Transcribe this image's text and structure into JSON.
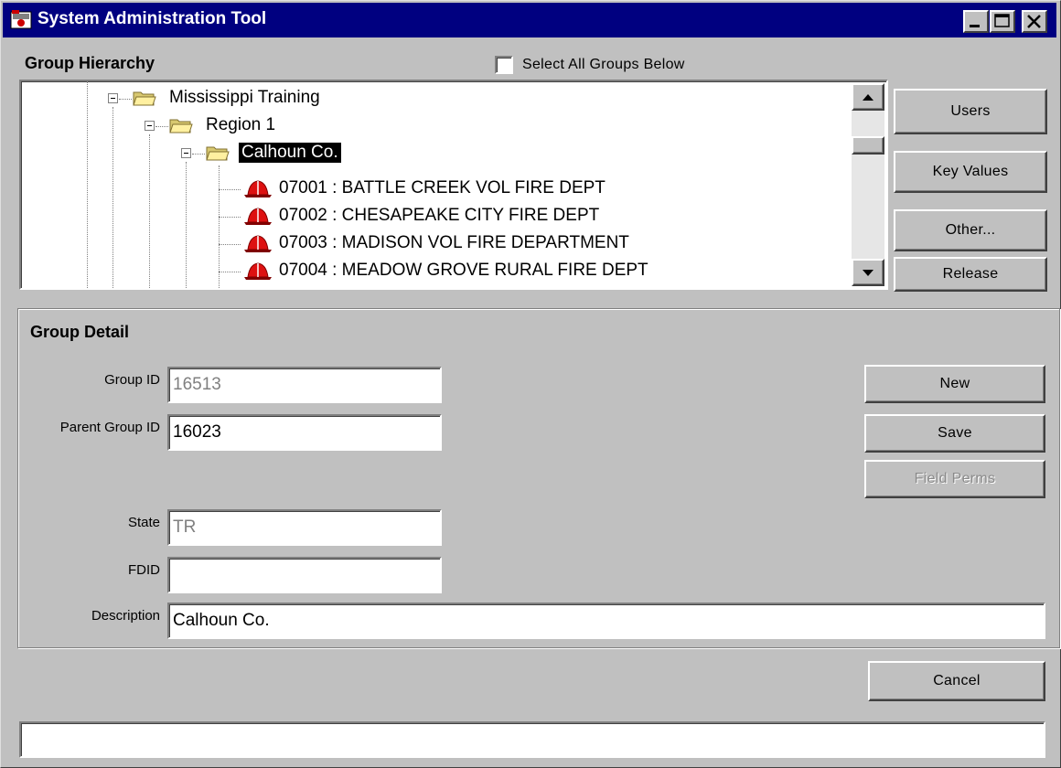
{
  "window": {
    "title": "System Administration Tool",
    "icon": "app-icon"
  },
  "hierarchy": {
    "title": "Group Hierarchy",
    "select_all_label": "Select All Groups Below",
    "select_all_checked": false,
    "tree": [
      {
        "label": "Mississippi Training",
        "type": "folder",
        "expanded": true
      },
      {
        "label": "Region 1",
        "type": "folder",
        "expanded": true
      },
      {
        "label": "Calhoun Co.",
        "type": "folder",
        "expanded": true,
        "selected": true
      },
      {
        "label": "07001 : BATTLE CREEK VOL FIRE DEPT",
        "type": "fire-helmet"
      },
      {
        "label": "07002 : CHESAPEAKE CITY FIRE DEPT",
        "type": "fire-helmet"
      },
      {
        "label": "07003 : MADISON VOL FIRE DEPARTMENT",
        "type": "fire-helmet"
      },
      {
        "label": "07004 : MEADOW GROVE RURAL FIRE DEPT",
        "type": "fire-helmet"
      }
    ],
    "buttons": {
      "users": "Users",
      "key_values": "Key Values",
      "other": "Other...",
      "release": "Release"
    }
  },
  "detail": {
    "title": "Group Detail",
    "fields": {
      "group_id": {
        "label": "Group ID",
        "value": "16513",
        "enabled": false
      },
      "parent_group_id": {
        "label": "Parent Group ID",
        "value": "16023",
        "enabled": true
      },
      "state": {
        "label": "State",
        "value": "TR",
        "enabled": false
      },
      "fdid": {
        "label": "FDID",
        "value": "",
        "enabled": true
      },
      "description": {
        "label": "Description",
        "value": "Calhoun Co.",
        "enabled": true
      }
    },
    "buttons": {
      "new": "New",
      "save": "Save",
      "field_perms": "Field Perms"
    }
  },
  "footer": {
    "cancel": "Cancel",
    "status_text": ""
  },
  "colors": {
    "title_bar": "#000080",
    "face": "#c0c0c0",
    "selection": "#000000",
    "helmet": "#cc0000"
  }
}
